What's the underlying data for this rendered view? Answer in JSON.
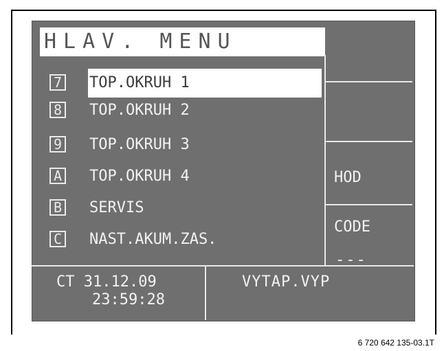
{
  "title": "HLAV. MENU",
  "menu": [
    {
      "key": "7",
      "label": "TOP.OKRUH 1",
      "selected": true
    },
    {
      "key": "8",
      "label": "TOP.OKRUH 2",
      "selected": false
    },
    {
      "key": "9",
      "label": "TOP.OKRUH 3",
      "selected": false
    },
    {
      "key": "A",
      "label": "TOP.OKRUH 4",
      "selected": false
    },
    {
      "key": "B",
      "label": "SERVIS",
      "selected": false
    },
    {
      "key": "C",
      "label": "NAST.AKUM.ZAS.",
      "selected": false
    }
  ],
  "side": {
    "hod": "HOD",
    "code": "CODE",
    "code_value": "---"
  },
  "footer": {
    "ct_prefix": "CT",
    "date": "31.12.09",
    "time": "23:59:28",
    "mode": "VYTAP.VYP"
  },
  "caption": "6 720 642 135-03.1T",
  "colors": {
    "lcd_background": "#6f6f6f",
    "text": "#f2f2f2",
    "highlight": "#ffffff"
  }
}
